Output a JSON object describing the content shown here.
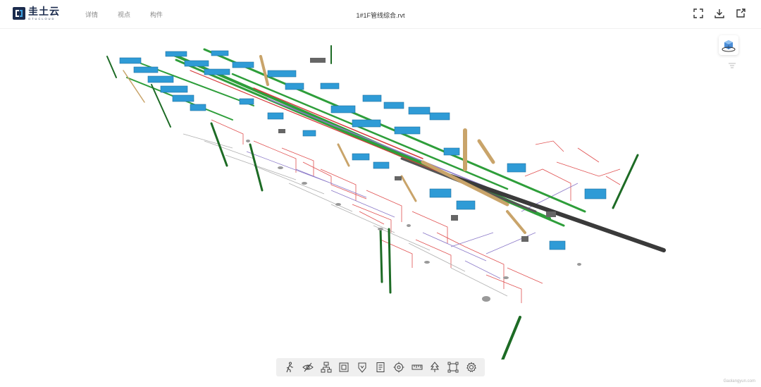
{
  "brand": {
    "name_cn": "圭土云",
    "name_en": "GTUCLOUD",
    "color": "#1b2b4d"
  },
  "nav": {
    "items": [
      "详情",
      "视点",
      "构件"
    ]
  },
  "file": {
    "title": "1#1F管线综合.rvt"
  },
  "top_actions": [
    "fullscreen-icon",
    "download-icon",
    "share-icon"
  ],
  "viewport": {
    "model": "MEP pipeline composite",
    "colors": {
      "duct": "#2f9bd6",
      "pipe_green": "#2e9e3a",
      "pipe_dark_green": "#1d6b25",
      "fire_red": "#d63a3a",
      "purple_pipe": "#8a78c8",
      "tan_duct": "#c9a46a",
      "dark_pipe": "#3a3a3a"
    }
  },
  "toolbar": {
    "tools": [
      "walk-icon",
      "hide-icon",
      "structure-icon",
      "section-box-icon",
      "marker-icon",
      "properties-icon",
      "focus-icon",
      "measure-icon",
      "tree-icon",
      "explode-icon",
      "settings-icon"
    ]
  },
  "watermark": {
    "text": "Gaolangyun.com"
  }
}
